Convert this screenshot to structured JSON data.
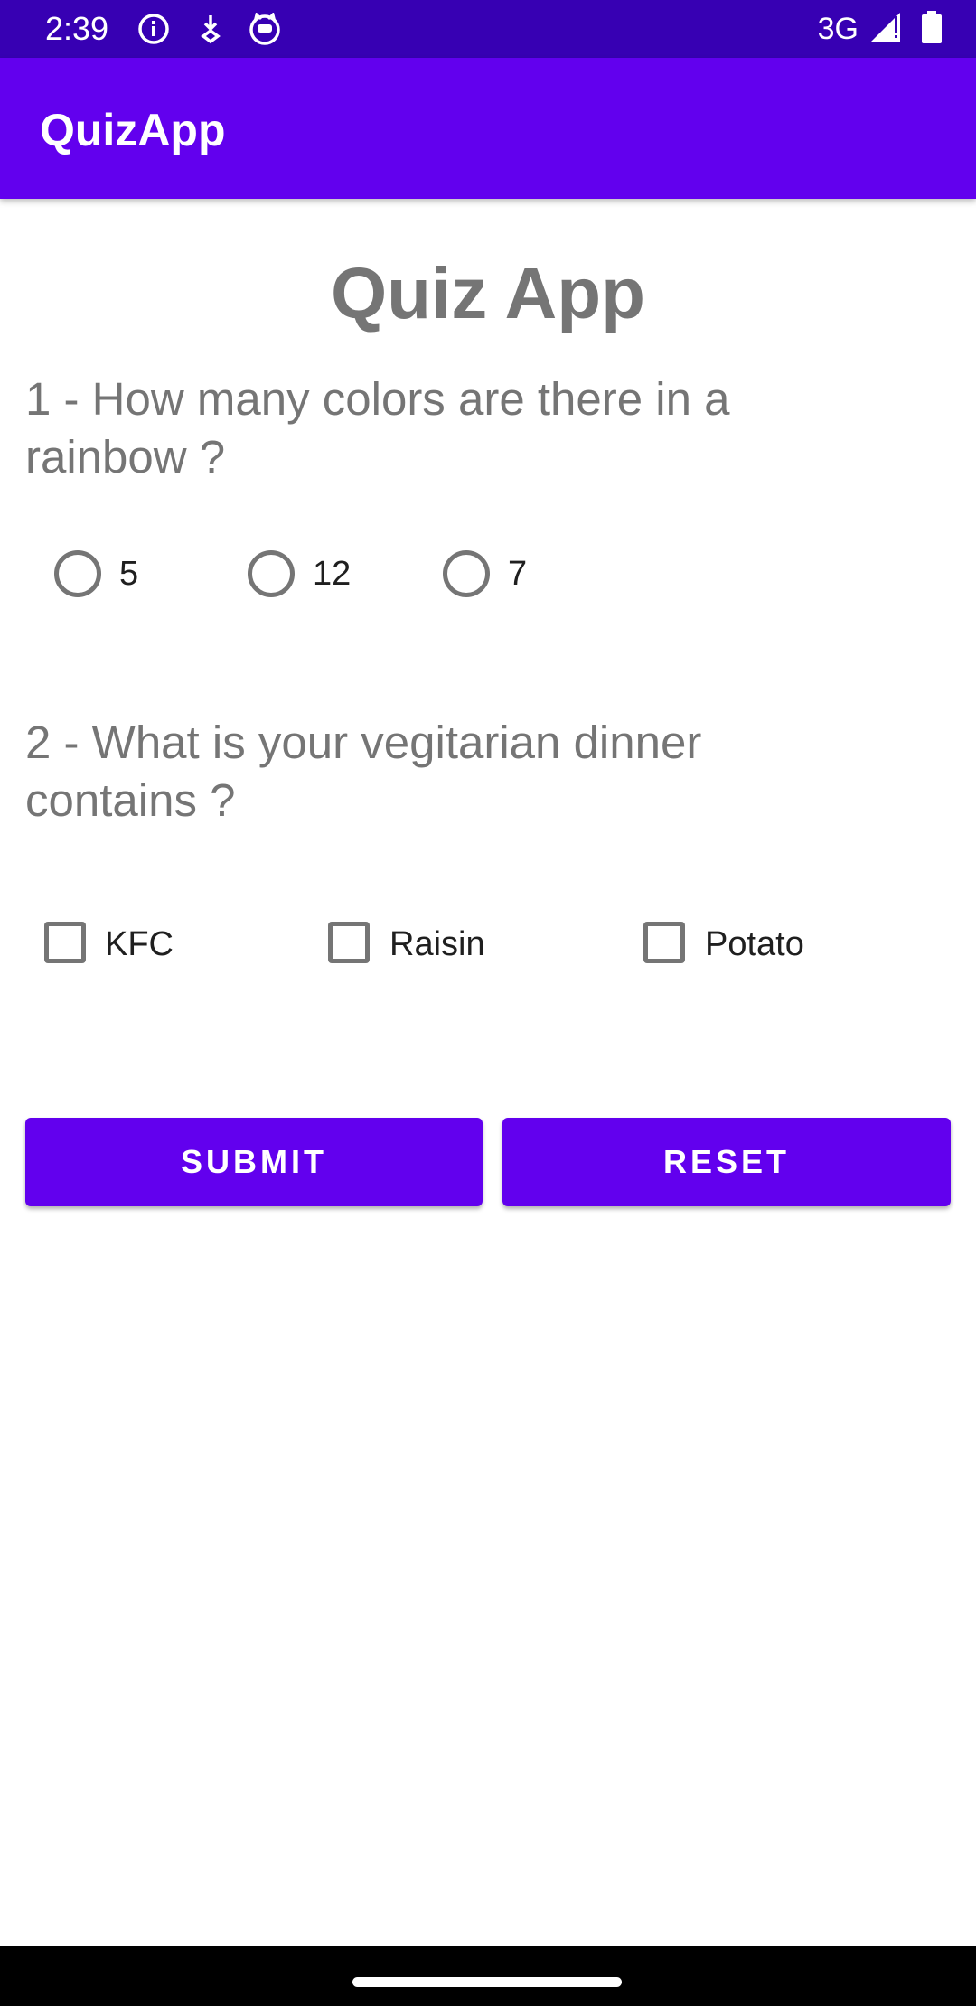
{
  "status_bar": {
    "time": "2:39",
    "network": "3G",
    "icons": [
      "info-icon",
      "download-icon",
      "cat-face-icon",
      "signal-icon",
      "battery-icon"
    ]
  },
  "app_bar": {
    "title": "QuizApp",
    "color": "#6200ee"
  },
  "main": {
    "title": "Quiz App",
    "question1": {
      "text": "1 - How many colors are there in a rainbow ?",
      "options": [
        "5",
        "12",
        "7"
      ]
    },
    "question2": {
      "text": "2 - What is your vegitarian dinner contains ?",
      "options": [
        "KFC",
        "Raisin",
        "Potato"
      ]
    },
    "buttons": {
      "submit": "SUBMIT",
      "reset": "RESET"
    }
  },
  "colors": {
    "status_bar": "#3700b3",
    "primary": "#6200ee",
    "text_gray": "#757575"
  }
}
